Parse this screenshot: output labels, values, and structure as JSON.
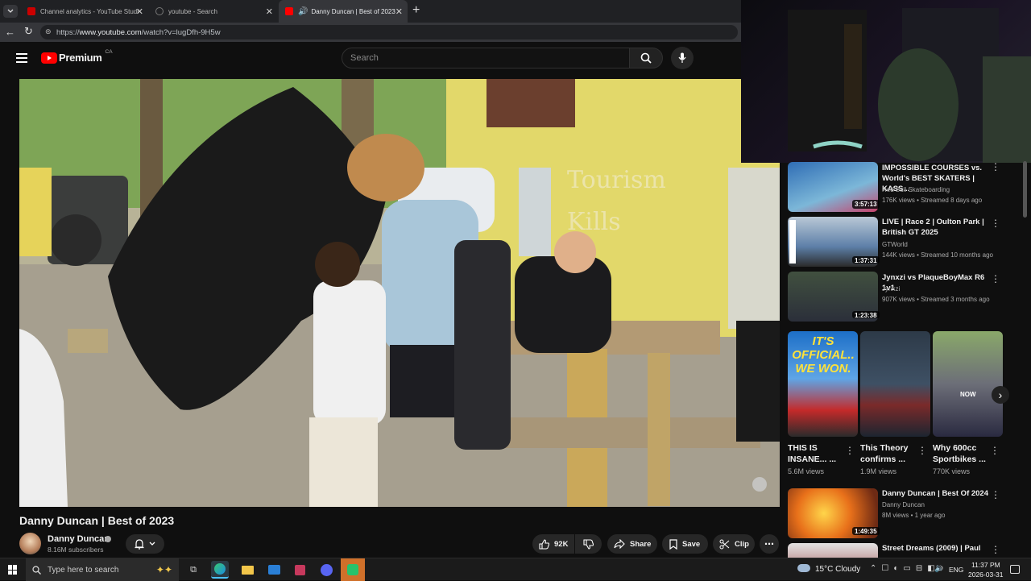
{
  "browser": {
    "tabs": [
      {
        "label": "Channel analytics - YouTube Studi"
      },
      {
        "label": "youtube - Search"
      },
      {
        "label": "Danny Duncan | Best of 2023"
      }
    ],
    "url_prefix": "https://",
    "url_host": "www.youtube.com",
    "url_path": "/watch?v=lugDfh-9H5w"
  },
  "header": {
    "logo_text": "Premium",
    "region": "CA",
    "search_placeholder": "Search"
  },
  "video": {
    "title": "Danny Duncan | Best of 2023",
    "wall_text": "Tourism Kills"
  },
  "channel": {
    "name": "Danny Duncan",
    "subscribers": "8.16M subscribers"
  },
  "actions": {
    "likes": "92K",
    "share": "Share",
    "save": "Save",
    "clip": "Clip"
  },
  "recommendations": [
    {
      "title": "IMPOSSIBLE COURSES vs. World's BEST SKATERS | KASS...",
      "channel": "Red Bull Skateboarding",
      "meta": "176K views • Streamed 8 days ago",
      "duration": "3:57:13",
      "thumb_color": "#2f6db5"
    },
    {
      "title": "LIVE | Race 2 | Oulton Park | British GT 2025",
      "channel": "GTWorld",
      "meta": "144K views • Streamed 10 months ago",
      "duration": "1:37:31",
      "thumb_color": "#5d7fa8"
    },
    {
      "title": "Jynxzi vs PlaqueBoyMax R6 1v1",
      "channel": "Jynxzi",
      "meta": "907K views • Streamed 3 months ago",
      "duration": "1:23:38",
      "thumb_color": "#3a4a3a"
    },
    {
      "title": "Danny Duncan | Best Of 2024",
      "channel": "Danny Duncan",
      "meta": "8M views • 1 year ago",
      "duration": "1:49:35",
      "thumb_color": "#d2561e"
    },
    {
      "title": "Street Dreams (2009) | Paul",
      "channel": "",
      "meta": "",
      "duration": "",
      "thumb_color": "#8a1f1f"
    }
  ],
  "shorts": [
    {
      "title": "THIS IS INSANE... ...",
      "views": "5.6M views",
      "overlay": "IT'S OFFICIAL.. WE WON."
    },
    {
      "title": "This Theory confirms ...",
      "views": "1.9M views",
      "overlay": ""
    },
    {
      "title": "Why 600cc Sportbikes ...",
      "views": "770K views",
      "overlay": "NOW"
    }
  ],
  "taskbar": {
    "search_placeholder": "Type here to search",
    "weather": "15°C Cloudy",
    "lang": "ENG",
    "time": "11:37 PM",
    "date": "2026-03-31"
  },
  "colors": {
    "youtube_red": "#ff0000",
    "bg": "#0f0f0f",
    "tab_active": "#35363a"
  }
}
